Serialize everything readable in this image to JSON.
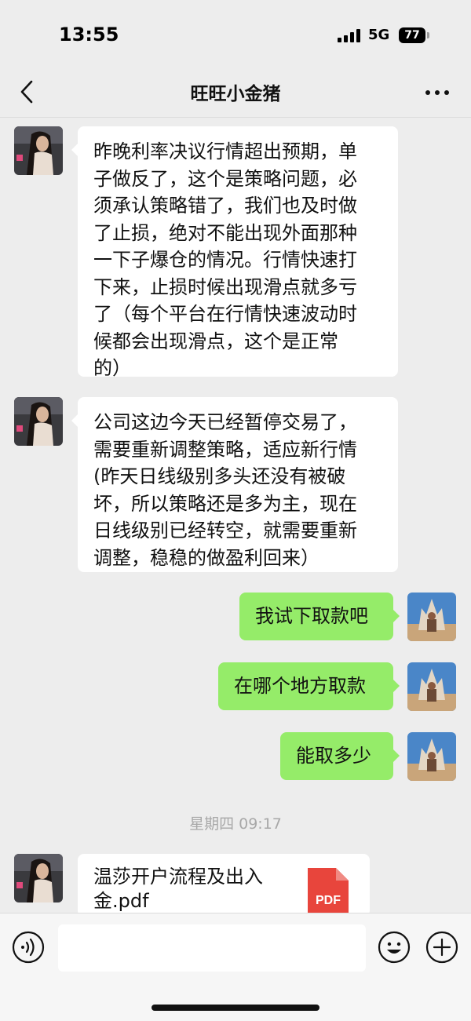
{
  "status_bar": {
    "time": "13:55",
    "network": "5G",
    "battery": "77"
  },
  "header": {
    "title": "旺旺小金猪",
    "back_icon": "chevron-left-icon",
    "more_icon": "ellipsis-icon"
  },
  "messages": [
    {
      "side": "left",
      "text": "昨晚利率决议行情超出预期，单\n子做反了，这个是策略问题，必\n须承认策略错了，我们也及时做\n了止损，绝对不能出现外面那种\n一下子爆仓的情况。行情快速打\n下来，止损时候出现滑点就多亏\n了（每个平台在行情快速波动时\n候都会出现滑点，这个是正常\n的）"
    },
    {
      "side": "left",
      "text": "公司这边今天已经暂停交易了，\n需要重新调整策略，适应新行情\n(昨天日线级别多头还没有被破\n坏，所以策略还是多为主，现在\n日线级别已经转空，就需要重新\n调整，稳稳的做盈利回来）"
    },
    {
      "side": "right",
      "text": "我试下取款吧"
    },
    {
      "side": "right",
      "text": "在哪个地方取款"
    },
    {
      "side": "right",
      "text": "能取多少"
    }
  ],
  "timestamp": "星期四 09:17",
  "file_message": {
    "name": "温莎开户流程及出入\n金.pdf",
    "badge": "PDF"
  },
  "input_bar": {
    "placeholder": "",
    "voice_icon": "voice-icon",
    "emoji_icon": "emoji-icon",
    "plus_icon": "plus-icon"
  },
  "colors": {
    "background": "#ededed",
    "sent_bubble": "#95ec69",
    "received_bubble": "#ffffff",
    "pdf_red": "#e8453c"
  }
}
